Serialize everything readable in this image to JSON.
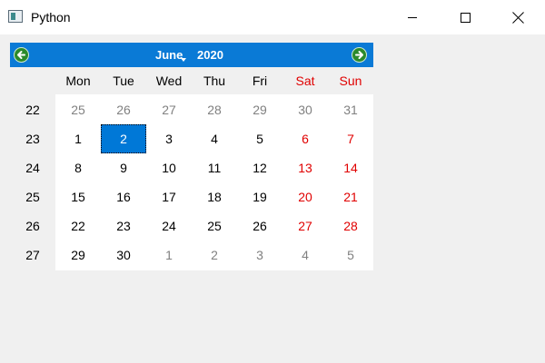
{
  "window": {
    "title": "Python",
    "icon": "python-window-icon"
  },
  "calendar": {
    "month": "June",
    "year": "2020",
    "prev_icon": "green-left-arrow-icon",
    "next_icon": "green-right-arrow-icon",
    "colors": {
      "nav_bar": "#0a7ad6",
      "selected": "#0078d7",
      "weekend": "#e00000",
      "other_month": "#808080"
    },
    "weekdays": [
      "Mon",
      "Tue",
      "Wed",
      "Thu",
      "Fri",
      "Sat",
      "Sun"
    ],
    "weeks": [
      {
        "week": "22",
        "days": [
          "25",
          "26",
          "27",
          "28",
          "29",
          "30",
          "31"
        ],
        "other": [
          true,
          true,
          true,
          true,
          true,
          true,
          true
        ]
      },
      {
        "week": "23",
        "days": [
          "1",
          "2",
          "3",
          "4",
          "5",
          "6",
          "7"
        ],
        "other": [
          false,
          false,
          false,
          false,
          false,
          false,
          false
        ]
      },
      {
        "week": "24",
        "days": [
          "8",
          "9",
          "10",
          "11",
          "12",
          "13",
          "14"
        ],
        "other": [
          false,
          false,
          false,
          false,
          false,
          false,
          false
        ]
      },
      {
        "week": "25",
        "days": [
          "15",
          "16",
          "17",
          "18",
          "19",
          "20",
          "21"
        ],
        "other": [
          false,
          false,
          false,
          false,
          false,
          false,
          false
        ]
      },
      {
        "week": "26",
        "days": [
          "22",
          "23",
          "24",
          "25",
          "26",
          "27",
          "28"
        ],
        "other": [
          false,
          false,
          false,
          false,
          false,
          false,
          false
        ]
      },
      {
        "week": "27",
        "days": [
          "29",
          "30",
          "1",
          "2",
          "3",
          "4",
          "5"
        ],
        "other": [
          false,
          false,
          true,
          true,
          true,
          true,
          true
        ]
      }
    ],
    "selected_day": "2"
  }
}
